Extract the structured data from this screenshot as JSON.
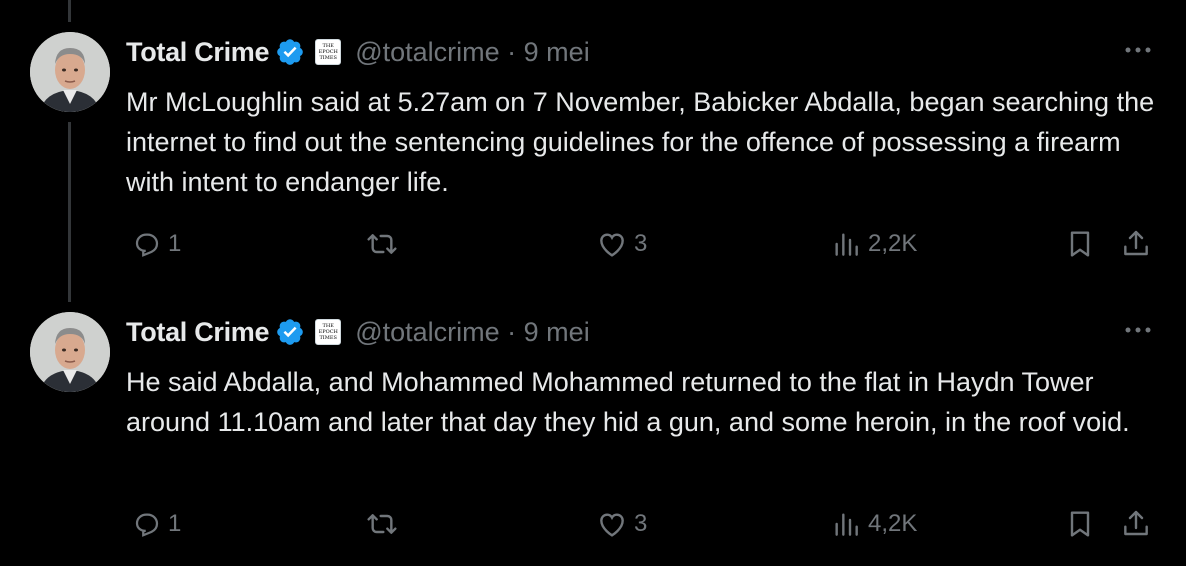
{
  "tweets": [
    {
      "name": "Total Crime",
      "affiliate_badge": "THE EPOCH TIMES",
      "handle_meta": "@totalcrime · 9 mei",
      "text": "Mr McLoughlin said at 5.27am on 7 November, Babicker Abdalla, began searching the internet to find out the sentencing guidelines for the offence of possessing a firearm with intent to endanger life.",
      "replies": "1",
      "likes": "3",
      "views": "2,2K"
    },
    {
      "name": "Total Crime",
      "affiliate_badge": "THE EPOCH TIMES",
      "handle_meta": "@totalcrime · 9 mei",
      "text": "He said Abdalla, and Mohammed Mohammed returned to the flat in Haydn Tower around 11.10am and later that day they hid a gun, and some heroin, in the roof void.",
      "replies": "1",
      "likes": "3",
      "views": "4,2K"
    }
  ],
  "icons": [
    "more-icon",
    "verified-badge-icon",
    "reply-icon",
    "retweet-icon",
    "like-icon",
    "views-icon",
    "bookmark-icon",
    "share-icon"
  ],
  "colors": {
    "background": "#000000",
    "text": "#e7e9ea",
    "muted": "#71767b",
    "verified": "#1d9bf0",
    "thread_line": "#333639"
  }
}
